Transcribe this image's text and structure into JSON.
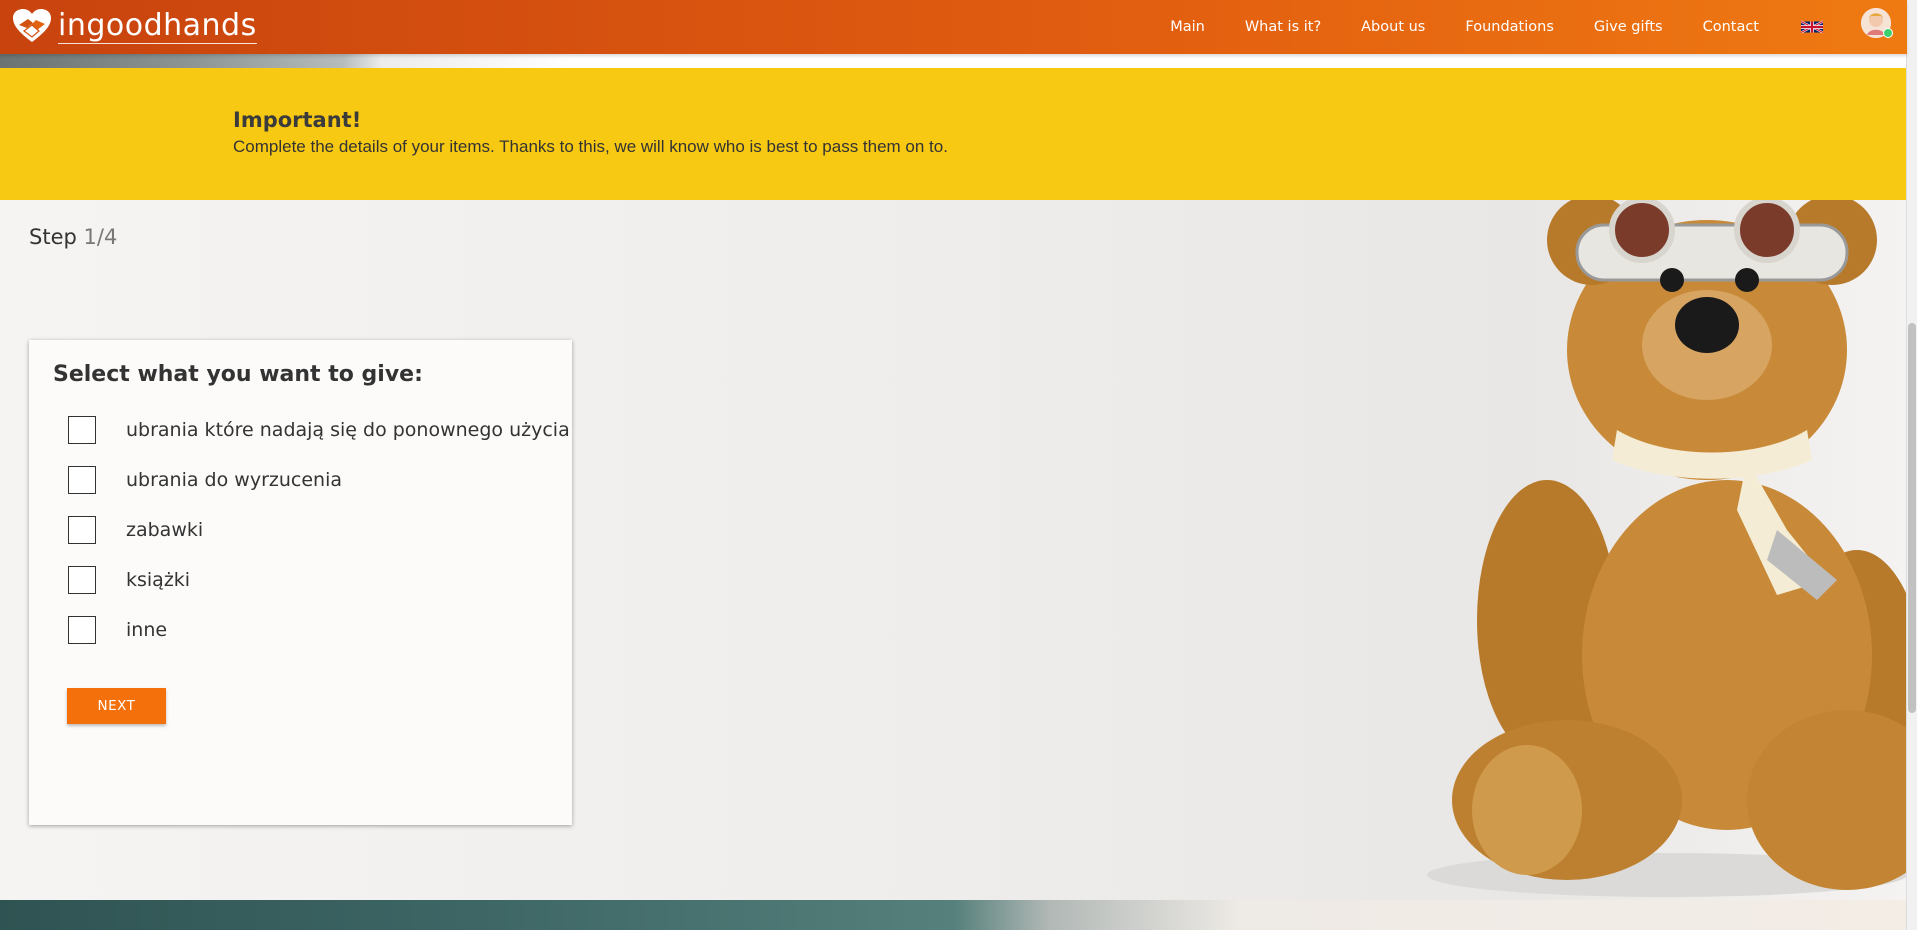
{
  "app": {
    "logo_text": "ingoodhands"
  },
  "nav": {
    "items": [
      "Main",
      "What is it?",
      "About us",
      "Foundations",
      "Give gifts",
      "Contact"
    ],
    "language_icon": "uk-flag-icon",
    "avatar_icon": "user-avatar-icon"
  },
  "banner": {
    "title": "Important!",
    "text": "Complete the details of your items. Thanks to this, we will know who is best to pass them on to."
  },
  "step": {
    "label": "Step",
    "number": "1/4"
  },
  "form": {
    "title": "Select what you want to give:",
    "options": [
      "ubrania które nadają się do ponownego użycia",
      "ubrania do wyrzucenia",
      "zabawki",
      "książki",
      "inne"
    ],
    "next_label": "NEXT"
  },
  "colors": {
    "nav_gradient_start": "#c8430e",
    "nav_gradient_end": "#ef7a12",
    "banner": "#f8c913",
    "button": "#f4700b"
  }
}
